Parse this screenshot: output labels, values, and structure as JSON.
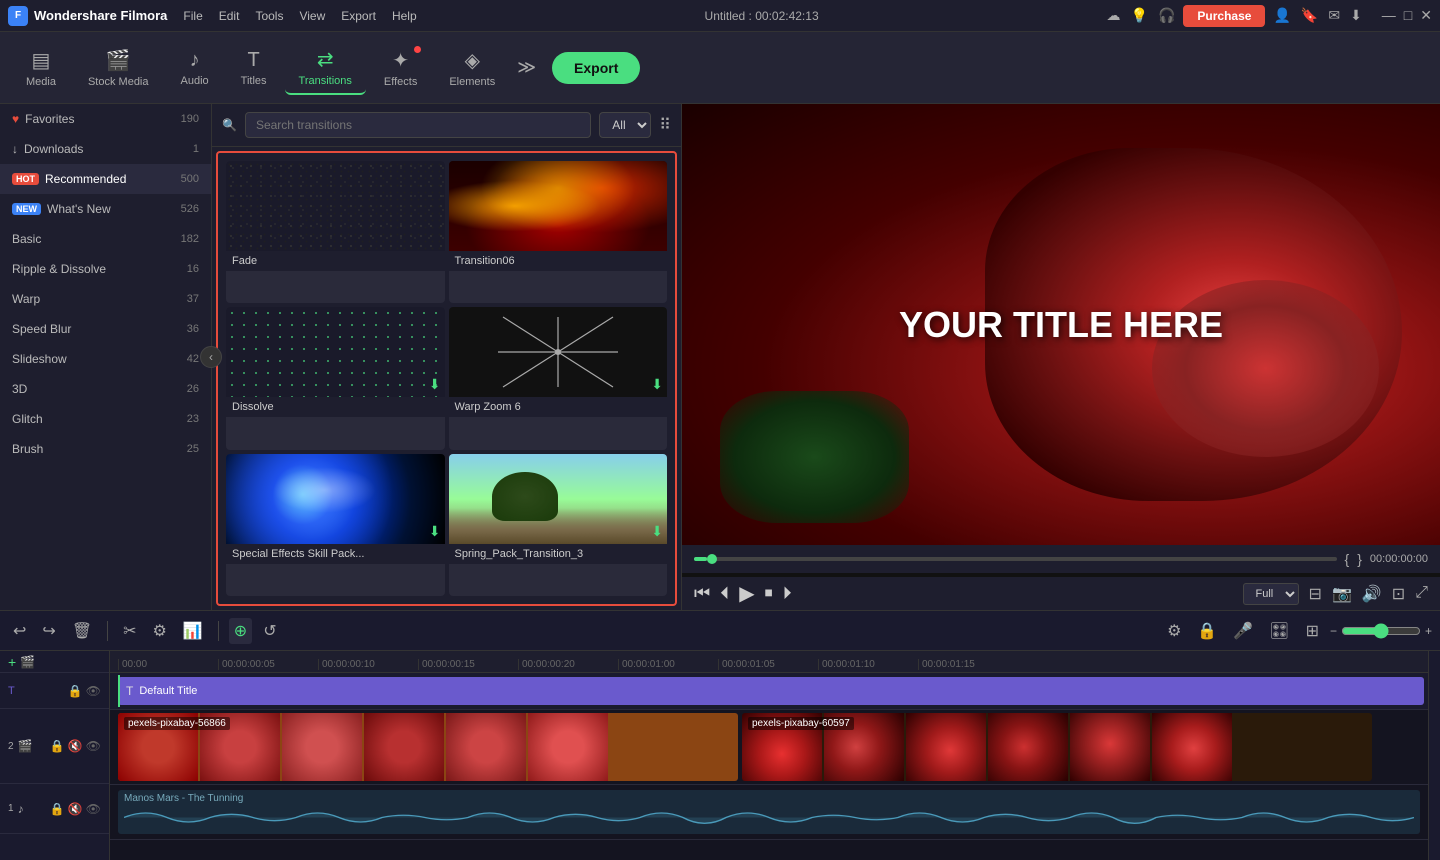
{
  "app": {
    "name": "Wondershare Filmora",
    "title": "Untitled : 00:02:42:13"
  },
  "titlebar": {
    "menu": [
      "File",
      "Edit",
      "Tools",
      "View",
      "Export",
      "Help"
    ],
    "purchase_label": "Purchase",
    "window_controls": [
      "—",
      "□",
      "✕"
    ]
  },
  "toolbar": {
    "items": [
      {
        "id": "media",
        "label": "Media",
        "icon": "▤"
      },
      {
        "id": "stock_media",
        "label": "Stock Media",
        "icon": "🎬"
      },
      {
        "id": "audio",
        "label": "Audio",
        "icon": "♪"
      },
      {
        "id": "titles",
        "label": "Titles",
        "icon": "T"
      },
      {
        "id": "transitions",
        "label": "Transitions",
        "icon": "⇄"
      },
      {
        "id": "effects",
        "label": "Effects",
        "icon": "✦"
      },
      {
        "id": "elements",
        "label": "Elements",
        "icon": "◈"
      }
    ],
    "export_label": "Export"
  },
  "sidebar": {
    "items": [
      {
        "id": "favorites",
        "label": "Favorites",
        "count": "190",
        "icon": "♥"
      },
      {
        "id": "downloads",
        "label": "Downloads",
        "count": "1",
        "icon": "↓"
      },
      {
        "id": "recommended",
        "label": "Recommended",
        "count": "500",
        "tag": "HOT"
      },
      {
        "id": "whats_new",
        "label": "What's New",
        "count": "526",
        "tag": "NEW"
      },
      {
        "id": "basic",
        "label": "Basic",
        "count": "182"
      },
      {
        "id": "ripple_dissolve",
        "label": "Ripple & Dissolve",
        "count": "16"
      },
      {
        "id": "warp",
        "label": "Warp",
        "count": "37"
      },
      {
        "id": "speed_blur",
        "label": "Speed Blur",
        "count": "36"
      },
      {
        "id": "slideshow",
        "label": "Slideshow",
        "count": "42"
      },
      {
        "id": "3d",
        "label": "3D",
        "count": "26"
      },
      {
        "id": "glitch",
        "label": "Glitch",
        "count": "23"
      },
      {
        "id": "brush",
        "label": "Brush",
        "count": "25"
      }
    ]
  },
  "transitions_panel": {
    "search_placeholder": "Search transitions",
    "filter": "All",
    "items": [
      {
        "id": "fade",
        "label": "Fade",
        "type": "dot-pattern"
      },
      {
        "id": "transition06",
        "label": "Transition06",
        "type": "fire"
      },
      {
        "id": "dissolve",
        "label": "Dissolve",
        "type": "dot-pattern-green"
      },
      {
        "id": "warp_zoom_6",
        "label": "Warp Zoom 6",
        "type": "warp"
      },
      {
        "id": "special_effects",
        "label": "Special Effects Skill Pack...",
        "type": "effects"
      },
      {
        "id": "spring_pack",
        "label": "Spring_Pack_Transition_3",
        "type": "spring"
      }
    ]
  },
  "preview": {
    "title_text": "YOUR TITLE HERE",
    "timecode": "00:00:00:00",
    "progress": 2,
    "quality": "Full",
    "controls": {
      "rewind": "⏮",
      "back": "⏪",
      "play": "▶",
      "stop": "⏹",
      "forward": "⏩"
    }
  },
  "timeline": {
    "ruler_marks": [
      "00:00",
      "00:00:00:05",
      "00:00:00:10",
      "00:00:00:15",
      "00:00:00:20",
      "00:00:01:00",
      "00:00:01:05",
      "00:00:01:10",
      "00:00:01:15"
    ],
    "tracks": [
      {
        "id": "title",
        "label": "Default Title",
        "icon": "T",
        "type": "title"
      },
      {
        "id": "video1",
        "label": "pexels-pixabay-56866",
        "icon": "▶",
        "type": "video"
      },
      {
        "id": "video2",
        "label": "pexels-pixabay-60597",
        "icon": "▶",
        "type": "video"
      },
      {
        "id": "audio",
        "label": "Manos Mars - The Tunning",
        "icon": "♪",
        "type": "audio"
      }
    ],
    "zoom_level": 50
  }
}
